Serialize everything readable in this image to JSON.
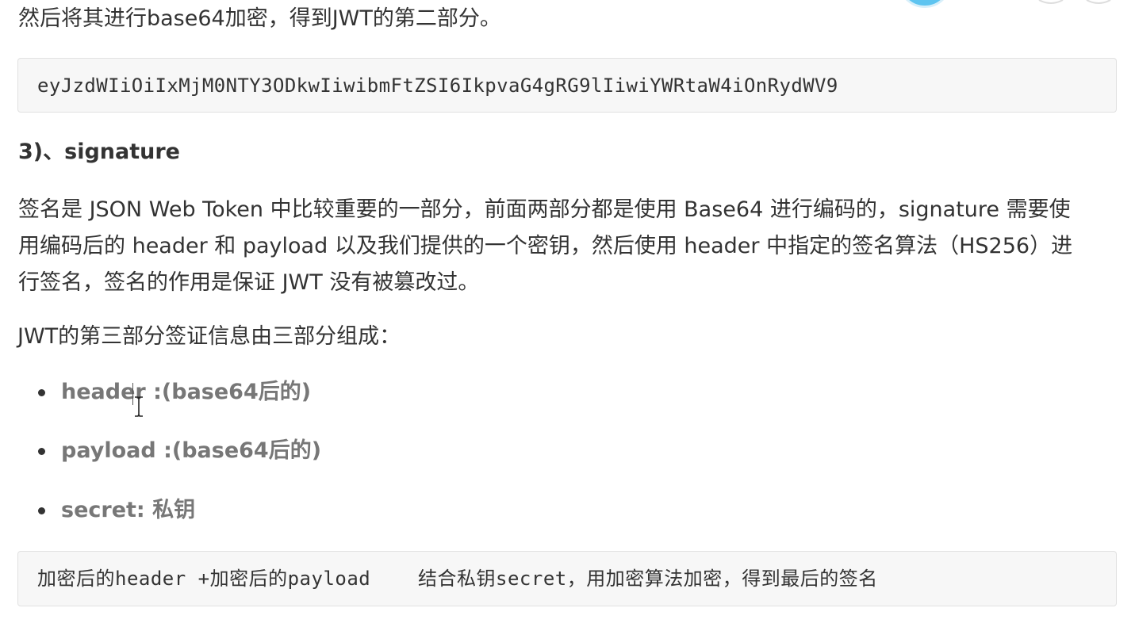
{
  "paragraph_top": "然后将其进行base64加密，得到JWT的第二部分。",
  "code_block_1": "eyJzdWIiOiIxMjM0NTY3ODkwIiwibmFtZSI6IkpvaG4gRG9lIiwiYWRtaW4iOnRydWV9",
  "heading": "3)、signature",
  "paragraph_main": {
    "line1": "签名是 JSON Web Token 中比较重要的一部分，前面两部分都是使用 Base64 进行编码的，signature 需要使",
    "line2": "用编码后的 header 和 payload 以及我们提供的一个密钥，然后使用 header 中指定的签名算法（HS256）进",
    "line3": "行签名，签名的作用是保证 JWT 没有被篡改过。"
  },
  "paragraph_sub": "JWT的第三部分签证信息由三部分组成：",
  "list_items": [
    "header :(base64后的)",
    "payload :(base64后的)",
    "secret: 私钥"
  ],
  "code_block_2": "加密后的header +加密后的payload    结合私钥secret，用加密算法加密，得到最后的签名",
  "colors": {
    "text": "#333333",
    "list_text": "#777777",
    "code_bg": "#f7f7f7",
    "code_border": "#e1e1e1",
    "corner_circle": "#5ec4f0"
  },
  "icons": {
    "cursor": "text-ibeam-cursor-icon"
  }
}
